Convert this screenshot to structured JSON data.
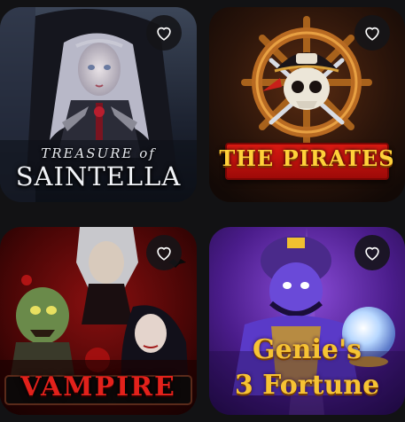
{
  "games": [
    {
      "title_line1": "TREASURE of",
      "title_line2": "SAINTELLA",
      "favorite_icon": "heart-outline-icon",
      "favorite": false
    },
    {
      "title_line1": "THE PIRATES",
      "favorite_icon": "heart-outline-icon",
      "favorite": false
    },
    {
      "title_line1": "VAMPIRE",
      "favorite_icon": "heart-outline-icon",
      "favorite": false
    },
    {
      "title_line1": "Genie's",
      "title_line2": "3 Fortune",
      "favorite_icon": "heart-outline-icon",
      "favorite": false
    }
  ],
  "colors": {
    "background": "#121214",
    "favorite_button_bg": "#141418",
    "heart_stroke": "#ffffff"
  }
}
